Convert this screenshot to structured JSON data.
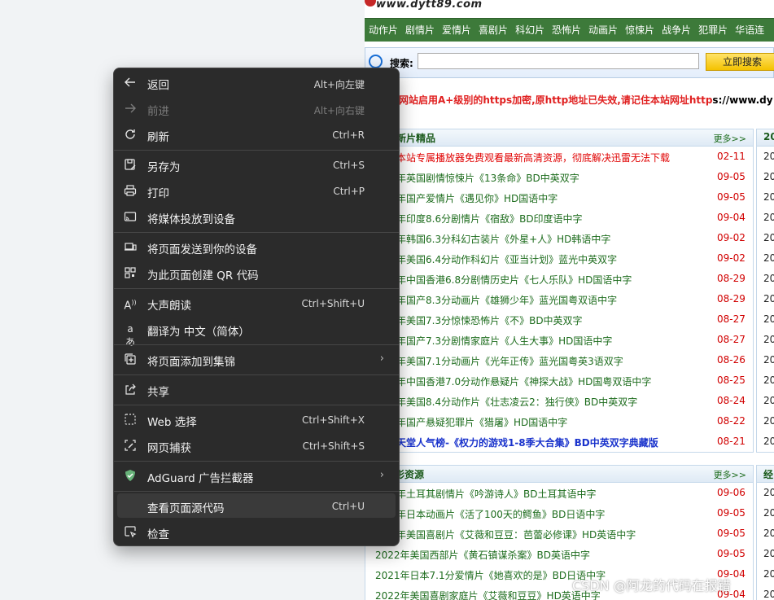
{
  "site": {
    "logo_text": "www.dytt89.com",
    "nav": [
      "动作片",
      "剧情片",
      "爱情片",
      "喜剧片",
      "科幻片",
      "恐怖片",
      "动画片",
      "惊悚片",
      "战争片",
      "犯罪片",
      "华语连"
    ],
    "search_label": "搜索:",
    "search_value": "",
    "search_button": "立即搜索",
    "notice_red": "网站启用A+级别的https加密,原http地址已失效,请记住本站网址http",
    "notice_black": "s://www.dy"
  },
  "panel1": {
    "title": "新片精品",
    "more": "更多>>",
    "rows": [
      {
        "title": "本站专属播放器免费观看最新高清资源，彻底解决迅雷无法下载",
        "date": "02-11"
      },
      {
        "title": "年英国剧情惊悚片《13条命》BD中英双字",
        "date": "09-05"
      },
      {
        "title": "年国产爱情片《遇见你》HD国语中字",
        "date": "09-05"
      },
      {
        "title": "年印度8.6分剧情片《宿敌》BD印度语中字",
        "date": "09-04"
      },
      {
        "title": "年韩国6.3分科幻古装片《外星+人》HD韩语中字",
        "date": "09-02"
      },
      {
        "title": "年美国6.4分动作科幻片《亚当计划》蓝光中英双字",
        "date": "09-02"
      },
      {
        "title": "年中国香港6.8分剧情历史片《七人乐队》HD国语中字",
        "date": "08-29"
      },
      {
        "title": "年国产8.3分动画片《雄狮少年》蓝光国粤双语中字",
        "date": "08-29"
      },
      {
        "title": "年美国7.3分惊悚恐怖片《不》BD中英双字",
        "date": "08-27"
      },
      {
        "title": "年国产7.3分剧情家庭片《人生大事》HD国语中字",
        "date": "08-27"
      },
      {
        "title": "年美国7.1分动画片《光年正传》蓝光国粤英3语双字",
        "date": "08-26"
      },
      {
        "title": "年中国香港7.0分动作悬疑片《神探大战》HD国粤双语中字",
        "date": "08-25"
      },
      {
        "title": "年美国8.4分动作片《壮志凌云2：独行侠》BD中英双字",
        "date": "08-24"
      },
      {
        "title": "年国产悬疑犯罪片《猎屠》HD国语中字",
        "date": "08-22"
      },
      {
        "title": "天堂人气榜-《权力的游戏1-8季大合集》BD中英双字典藏版",
        "date": "08-21"
      }
    ]
  },
  "panel2": {
    "title": "影资源",
    "more": "更多>>",
    "rows": [
      {
        "title": "年土耳其剧情片《吟游诗人》BD土耳其语中字",
        "date": "09-06"
      },
      {
        "title": "年日本动画片《活了100天的鳄鱼》BD日语中字",
        "date": "09-05"
      },
      {
        "title": "年美国喜剧片《艾薇和豆豆：芭蕾必修课》HD英语中字",
        "date": "09-05"
      },
      {
        "title": "2022年美国西部片《黄石镇谋杀案》BD英语中字",
        "date": "09-05"
      },
      {
        "title": "2021年日本7.1分爱情片《她喜欢的是》BD日语中字",
        "date": "09-04"
      },
      {
        "title": "2022年美国喜剧家庭片《艾薇和豆豆》HD英语中字",
        "date": "09-04"
      }
    ]
  },
  "side1": {
    "title": "20",
    "rows": [
      "20",
      "20",
      "20",
      "20",
      "20",
      "20",
      "20",
      "20",
      "20",
      "20",
      "20",
      "20",
      "20",
      "20",
      "20"
    ]
  },
  "side2": {
    "title": "经",
    "rows": [
      "20",
      "20",
      "20",
      "20",
      "20",
      "20"
    ]
  },
  "side1_extra": "dy",
  "watermark": "CSDN @阿龙的代码在报错",
  "context_menu": {
    "items": [
      {
        "label": "返回",
        "shortcut": "Alt+向左键",
        "icon": "back-arrow-icon",
        "enabled": true
      },
      {
        "label": "前进",
        "shortcut": "Alt+向右键",
        "icon": "forward-arrow-icon",
        "enabled": false
      },
      {
        "label": "刷新",
        "shortcut": "Ctrl+R",
        "icon": "refresh-icon",
        "enabled": true
      },
      {
        "label": "另存为",
        "shortcut": "Ctrl+S",
        "icon": "save-as-icon",
        "enabled": true
      },
      {
        "label": "打印",
        "shortcut": "Ctrl+P",
        "icon": "printer-icon",
        "enabled": true
      },
      {
        "label": "将媒体投放到设备",
        "shortcut": "",
        "icon": "cast-icon",
        "enabled": true
      },
      {
        "label": "将页面发送到你的设备",
        "shortcut": "",
        "icon": "send-to-device-icon",
        "enabled": true
      },
      {
        "label": "为此页面创建 QR 代码",
        "shortcut": "",
        "icon": "qr-code-icon",
        "enabled": true
      },
      {
        "label": "大声朗读",
        "shortcut": "Ctrl+Shift+U",
        "icon": "read-aloud-icon",
        "enabled": true
      },
      {
        "label": "翻译为 中文（简体）",
        "shortcut": "",
        "icon": "translate-icon",
        "enabled": true
      },
      {
        "label": "将页面添加到集锦",
        "shortcut": "",
        "icon": "collections-icon",
        "enabled": true,
        "submenu": true
      },
      {
        "label": "共享",
        "shortcut": "",
        "icon": "share-icon",
        "enabled": true
      },
      {
        "label": "Web 选择",
        "shortcut": "Ctrl+Shift+X",
        "icon": "web-select-icon",
        "enabled": true
      },
      {
        "label": "网页捕获",
        "shortcut": "Ctrl+Shift+S",
        "icon": "web-capture-icon",
        "enabled": true
      },
      {
        "label": "AdGuard 广告拦截器",
        "shortcut": "",
        "icon": "adguard-shield-icon",
        "enabled": true,
        "submenu": true
      },
      {
        "label": "查看页面源代码",
        "shortcut": "Ctrl+U",
        "icon": "",
        "enabled": true,
        "highlighted": true
      },
      {
        "label": "检查",
        "shortcut": "",
        "icon": "inspect-icon",
        "enabled": true
      }
    ]
  },
  "colors": {
    "menu_bg": "#2b2b2b",
    "nav_bg": "#3d7a3a",
    "date_red": "#d10000",
    "title_green": "#1d6c1d"
  }
}
